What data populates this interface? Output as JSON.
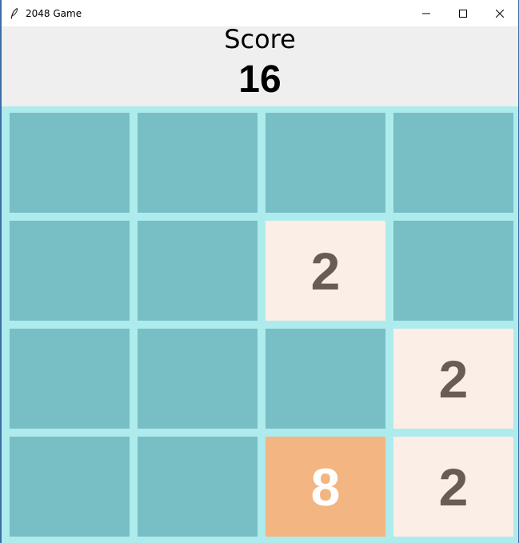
{
  "window": {
    "title": "2048 Game",
    "icon": "feather-icon",
    "controls": [
      "minimize-icon",
      "maximize-icon",
      "close-icon"
    ]
  },
  "score": {
    "label": "Score",
    "value": "16"
  },
  "colors": {
    "empty": "#78bec5",
    "tile_2_bg": "#fbeee6",
    "tile_2_fg": "#695c57",
    "tile_8_bg": "#f3b581",
    "tile_8_fg": "#ffffff",
    "board_bg": "#aeebec",
    "header_bg": "#efefef"
  },
  "board": {
    "rows": [
      [
        "",
        "",
        "",
        ""
      ],
      [
        "",
        "",
        "2",
        ""
      ],
      [
        "",
        "",
        "",
        "2"
      ],
      [
        "",
        "",
        "8",
        "2"
      ]
    ]
  }
}
